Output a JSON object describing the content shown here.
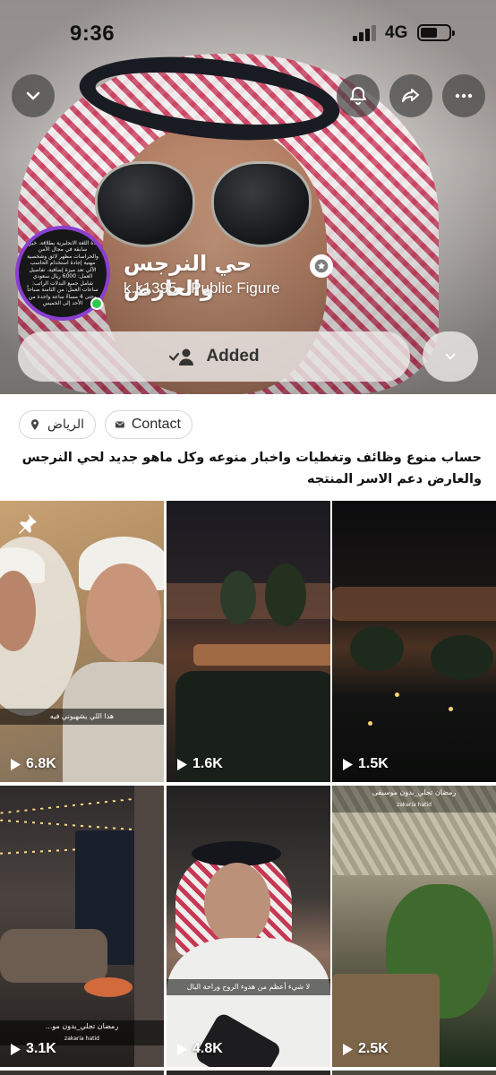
{
  "status_bar": {
    "time": "9:36",
    "network": "4G"
  },
  "top_actions": {
    "back_icon": "chevron-down-icon",
    "notify_icon": "bell-icon",
    "share_icon": "share-arrow-icon",
    "more_icon": "ellipsis-icon"
  },
  "profile": {
    "name": "حي النرجس والعارض",
    "username": "k.k1395",
    "separator": "·",
    "category": "Public Figure",
    "avatar_text": "مدة اللغة الانجليزية بطلاقة. خبرة سابقة في مجال الأمن والحراسات مظهر لائق وشخصية مهنية إجادة استخدام الحاسب الآلي تعد ميزة إضافية. تفاصيل العمل: 6000 ريال سعودي شامل جميع البدلات الراتب: ساعات العمل: من الثامنة صباحاً وحتى 4 مساءً ساعة واحدة من الأحد إلى الخميس",
    "added_label": "Added"
  },
  "chips": {
    "location": "الرياض",
    "contact": "Contact"
  },
  "bio": "حساب منوع وظائف وتغطيات واخبار منوعه وكل ماهو جديد لحي النرجس والعارض دعم الاسر المنتجه",
  "grid": [
    {
      "views": "6.8K",
      "caption": "هذا اللي يشهيوني فيه",
      "pinned": true
    },
    {
      "views": "1.6K",
      "caption": ""
    },
    {
      "views": "1.5K",
      "caption": ""
    },
    {
      "views": "3.1K",
      "caption": "رمضان تجلي_بدون مو...",
      "credit": "zakaria hatid"
    },
    {
      "views": "4.8K",
      "caption": "لا شيء أعظم من هدوء الروح وراحة البال"
    },
    {
      "views": "2.5K",
      "caption": "رمضان تجلي_بدون موسيقى",
      "credit": "zakaria hatid"
    }
  ],
  "colors": {
    "avatar_ring": "#8a3fd1",
    "online": "#32c94b"
  }
}
